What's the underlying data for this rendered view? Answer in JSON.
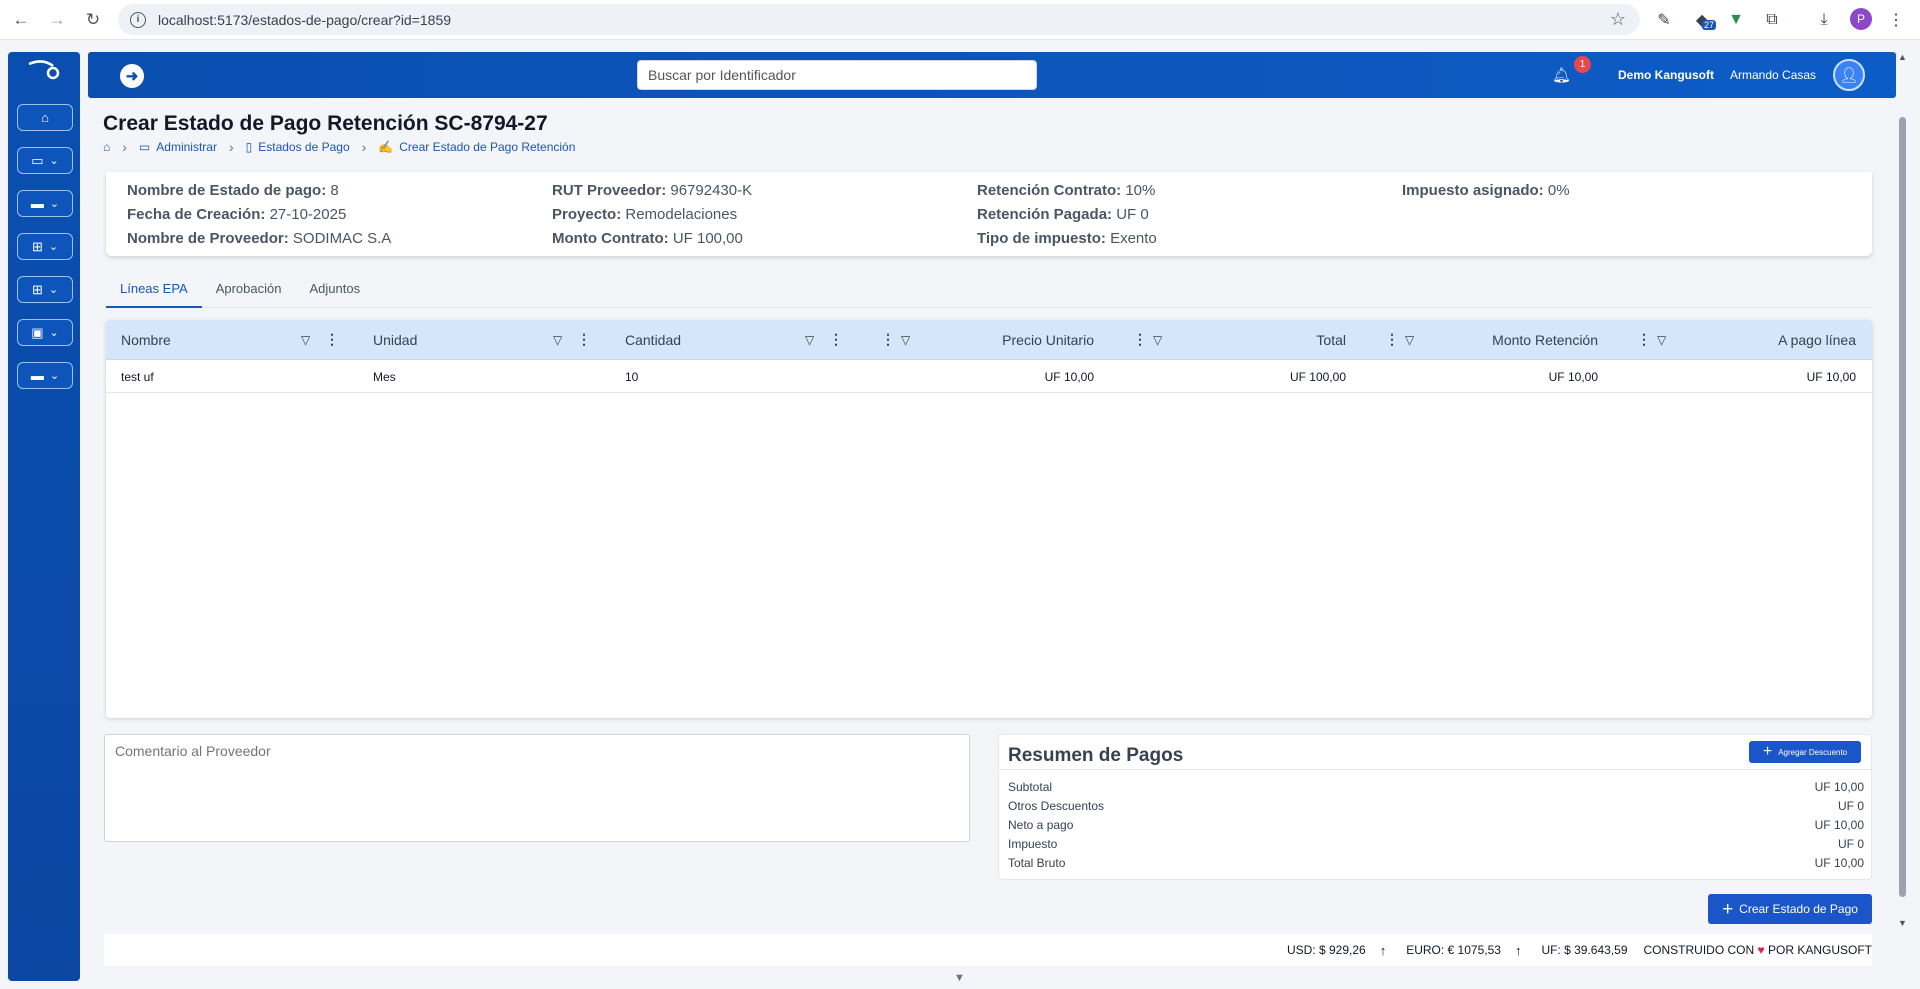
{
  "browser": {
    "url": "localhost:5173/estados-de-pago/crear?id=1859",
    "extension_badge": "27",
    "profile_initial": "P"
  },
  "header": {
    "search_placeholder": "Buscar por Identificador",
    "notifications_count": "1",
    "company": "Demo Kangusoft",
    "user": "Armando Casas"
  },
  "page": {
    "title": "Crear Estado de Pago Retención SC-8794-27",
    "breadcrumb": [
      "Administrar",
      "Estados de Pago",
      "Crear Estado de Pago Retención"
    ]
  },
  "info": {
    "col1": [
      {
        "label": "Nombre de Estado de pago:",
        "value": "8"
      },
      {
        "label": "Fecha de Creación:",
        "value": "27-10-2025"
      },
      {
        "label": "Nombre de Proveedor:",
        "value": "SODIMAC S.A"
      }
    ],
    "col2": [
      {
        "label": "RUT Proveedor:",
        "value": "96792430-K"
      },
      {
        "label": "Proyecto:",
        "value": "Remodelaciones"
      },
      {
        "label": "Monto Contrato:",
        "value": "UF 100,00"
      }
    ],
    "col3": [
      {
        "label": "Retención Contrato:",
        "value": "10%"
      },
      {
        "label": "Retención Pagada:",
        "value": "UF 0"
      },
      {
        "label": "Tipo de impuesto:",
        "value": "Exento"
      }
    ],
    "col4": [
      {
        "label": "Impuesto asignado:",
        "value": "0%"
      }
    ]
  },
  "tabs": [
    "Líneas EPA",
    "Aprobación",
    "Adjuntos"
  ],
  "table": {
    "headers": [
      "Nombre",
      "Unidad",
      "Cantidad",
      "Precio Unitario",
      "Total",
      "Monto Retención",
      "A pago línea"
    ],
    "rows": [
      [
        "test uf",
        "Mes",
        "10",
        "UF 10,00",
        "UF 100,00",
        "UF 10,00",
        "UF 10,00"
      ]
    ]
  },
  "comment_placeholder": "Comentario al Proveedor",
  "summary": {
    "title": "Resumen de Pagos",
    "add_discount": "Agregar Descuento",
    "rows": [
      {
        "label": "Subtotal",
        "value": "UF 10,00"
      },
      {
        "label": "Otros Descuentos",
        "value": "UF 0"
      },
      {
        "label": "Neto a pago",
        "value": "UF 10,00"
      },
      {
        "label": "Impuesto",
        "value": "UF 0"
      },
      {
        "label": "Total Bruto",
        "value": "UF 10,00"
      }
    ]
  },
  "create_button": "Crear Estado de Pago",
  "footer": {
    "usd": "USD: $ 929,26",
    "euro": "EURO: € 1075,53",
    "uf": "UF: $ 39.643,59",
    "built_pre": "CONSTRUIDO CON",
    "built_post": "POR KANGUSOFT"
  }
}
